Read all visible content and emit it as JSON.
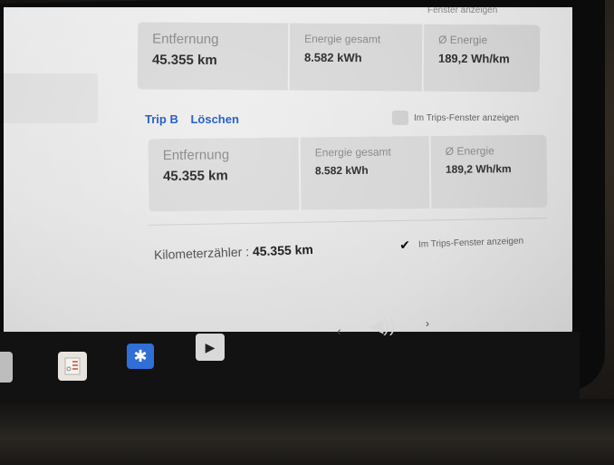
{
  "screen": {
    "top_caption": "Fenster anzeigen",
    "trip_a": {
      "distance_label": "Entfernung",
      "distance_value": "45.355 km",
      "energy_total_label": "Energie gesamt",
      "energy_total_value": "8.582 kWh",
      "energy_avg_label": "Ø Energie",
      "energy_avg_value": "189,2 Wh/km"
    },
    "trip_b": {
      "name": "Trip B",
      "reset_label": "Löschen",
      "show_toggle_label": "Im Trips-Fenster anzeigen",
      "show_toggle_checked": false,
      "distance_label": "Entfernung",
      "distance_value": "45.355 km",
      "energy_total_label": "Energie gesamt",
      "energy_total_value": "8.582 kWh",
      "energy_avg_label": "Ø Energie",
      "energy_avg_value": "189,2 Wh/km"
    },
    "odometer": {
      "label": "Kilometerzähler :",
      "value": "45.355 km",
      "show_toggle_label": "Im Trips-Fenster anzeigen",
      "show_toggle_checked": true
    }
  },
  "taskbar": {
    "icons": [
      "document-icon",
      "bluetooth-icon",
      "media-player-icon",
      "volume-icon"
    ],
    "bluetooth_glyph": "✱",
    "media_glyph": "▶",
    "volume_glyph": "◀))",
    "prev_glyph": "‹",
    "next_glyph": "›",
    "check_glyph": "✔"
  },
  "colors": {
    "accent": "#2a62c9",
    "bluetooth": "#2f6fd6",
    "screen_bg": "#f0f0f0",
    "panel_bg": "#dedede"
  }
}
